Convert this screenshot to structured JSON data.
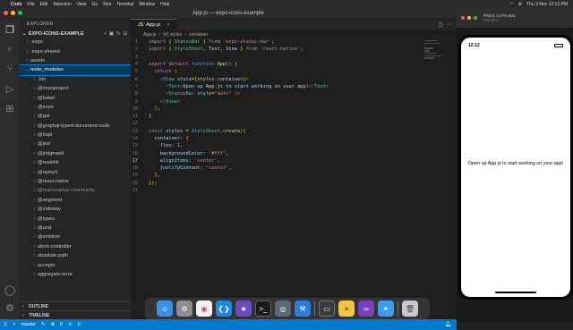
{
  "menubar": {
    "app": "Code",
    "items": [
      "File",
      "Edit",
      "Selection",
      "View",
      "Go",
      "Run",
      "Terminal",
      "Window",
      "Help"
    ],
    "clock": "Thu 3 Nov 12:12 PM"
  },
  "window": {
    "title": "App.js — expo-icons-example"
  },
  "sidebar": {
    "header": "EXPLORER",
    "project": "EXPO-ICONS-EXAMPLE",
    "folders": [
      {
        "label": ".expo",
        "level": 1,
        "expanded": false
      },
      {
        "label": ".expo-shared",
        "level": 1,
        "expanded": false
      },
      {
        "label": "assets",
        "level": 1,
        "expanded": false
      },
      {
        "label": "node_modules",
        "level": 1,
        "expanded": true,
        "selected": true
      },
      {
        "label": ".bin",
        "level": 2
      },
      {
        "label": "@expoproject",
        "level": 2
      },
      {
        "label": "@babel",
        "level": 2
      },
      {
        "label": "@expo",
        "level": 2
      },
      {
        "label": "@gar",
        "level": 2
      },
      {
        "label": "@graphql-typed-document-node",
        "level": 2
      },
      {
        "label": "@hapi",
        "level": 2
      },
      {
        "label": "@jest",
        "level": 2
      },
      {
        "label": "@jridgewell",
        "level": 2
      },
      {
        "label": "@nodelib",
        "level": 2
      },
      {
        "label": "@npmcli",
        "level": 2
      },
      {
        "label": "@react-native",
        "level": 2
      },
      {
        "label": "@react-native-community",
        "level": 2
      },
      {
        "label": "@segment",
        "level": 2
      },
      {
        "label": "@sideway",
        "level": 2
      },
      {
        "label": "@types",
        "level": 2
      },
      {
        "label": "@urql",
        "level": 2
      },
      {
        "label": "@xmldom",
        "level": 2
      },
      {
        "label": "abort-controller",
        "level": 2
      },
      {
        "label": "absolute-path",
        "level": 2
      },
      {
        "label": "accepts",
        "level": 2
      },
      {
        "label": "aggregate-error",
        "level": 2
      }
    ],
    "outline": "OUTLINE",
    "timeline": "TIMELINE"
  },
  "editor": {
    "tab": "App.js",
    "breadcrumb": [
      "App.js",
      "{#} styles",
      "container"
    ],
    "lines": [
      {
        "n": "1",
        "code": "import { StatusBar } from 'expo-status-bar';"
      },
      {
        "n": "2",
        "code": "import { StyleSheet, Text, View } from 'react-native';"
      },
      {
        "n": "3",
        "code": ""
      },
      {
        "n": "4",
        "code": "export default function App() {"
      },
      {
        "n": "5",
        "code": "  return ("
      },
      {
        "n": "6",
        "code": "    <View style={styles.container}>"
      },
      {
        "n": "7",
        "code": "      <Text>Open up App.js to start working on your app!</Text>"
      },
      {
        "n": "8",
        "code": "      <StatusBar style=\"auto\" />"
      },
      {
        "n": "9",
        "code": "    </View>"
      },
      {
        "n": "10",
        "code": "  );"
      },
      {
        "n": "11",
        "code": "}"
      },
      {
        "n": "12",
        "code": ""
      },
      {
        "n": "13",
        "code": "const styles = StyleSheet.create({"
      },
      {
        "n": "14",
        "code": "  container: {"
      },
      {
        "n": "15",
        "code": "    flex: 1,"
      },
      {
        "n": "16",
        "code": "    backgroundColor: '#fff',"
      },
      {
        "n": "17",
        "code": "    alignItems: 'center',"
      },
      {
        "n": "18",
        "code": "    justifyContent: 'center',"
      },
      {
        "n": "19",
        "code": "  },"
      },
      {
        "n": "20",
        "code": "});"
      },
      {
        "n": "21",
        "code": ""
      }
    ],
    "current_line": "17"
  },
  "statusbar": {
    "branch": "master",
    "errors": "0",
    "warnings": "0"
  },
  "simulator": {
    "title": "iPhone 13 Pro Max",
    "subtitle": "iOS 15.5",
    "time": "12:12",
    "message": "Open up App.js to start working on your app!"
  },
  "dock": {
    "apps": [
      "finder-icon",
      "settings-icon",
      "chrome-icon",
      "vscode-icon",
      "imovie-icon",
      "terminal-icon",
      "quicktime-icon",
      "xcode-icon",
      "simulator-icon",
      "notes-icon",
      "visual-studio-icon",
      "safari-icon",
      "trash-icon"
    ]
  }
}
